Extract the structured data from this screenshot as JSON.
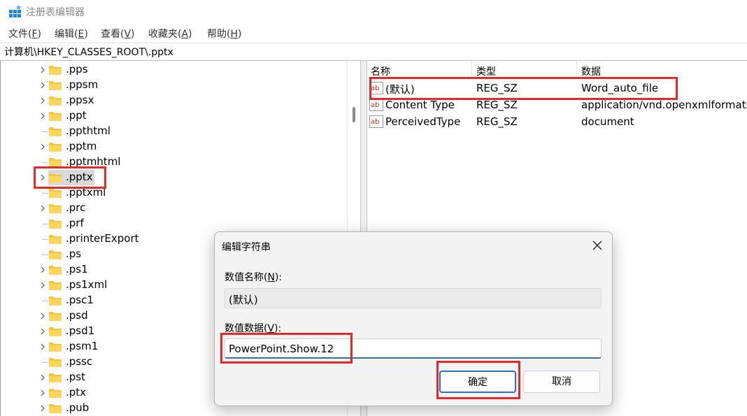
{
  "window": {
    "title": "注册表编辑器"
  },
  "menu": [
    {
      "label": "文件(",
      "key": "F",
      "suffix": ")"
    },
    {
      "label": "编辑(",
      "key": "E",
      "suffix": ")"
    },
    {
      "label": "查看(",
      "key": "V",
      "suffix": ")"
    },
    {
      "label": "收藏夹(",
      "key": "A",
      "suffix": ")"
    },
    {
      "label": "帮助(",
      "key": "H",
      "suffix": ")"
    }
  ],
  "address": "计算机\\HKEY_CLASSES_ROOT\\.pptx",
  "tree": [
    {
      "label": ".pps",
      "expandable": true
    },
    {
      "label": ".ppsm",
      "expandable": true
    },
    {
      "label": ".ppsx",
      "expandable": true
    },
    {
      "label": ".ppt",
      "expandable": true
    },
    {
      "label": ".ppthtml",
      "expandable": false
    },
    {
      "label": ".pptm",
      "expandable": true
    },
    {
      "label": ".pptmhtml",
      "expandable": false
    },
    {
      "label": ".pptx",
      "expandable": true,
      "selected": true
    },
    {
      "label": ".pptxml",
      "expandable": false
    },
    {
      "label": ".prc",
      "expandable": true
    },
    {
      "label": ".prf",
      "expandable": false
    },
    {
      "label": ".printerExport",
      "expandable": false
    },
    {
      "label": ".ps",
      "expandable": false
    },
    {
      "label": ".ps1",
      "expandable": true
    },
    {
      "label": ".ps1xml",
      "expandable": true
    },
    {
      "label": ".psc1",
      "expandable": false
    },
    {
      "label": ".psd",
      "expandable": true
    },
    {
      "label": ".psd1",
      "expandable": true
    },
    {
      "label": ".psm1",
      "expandable": true
    },
    {
      "label": ".pssc",
      "expandable": false
    },
    {
      "label": ".pst",
      "expandable": true
    },
    {
      "label": ".ptx",
      "expandable": true
    },
    {
      "label": ".pub",
      "expandable": true
    }
  ],
  "list": {
    "headers": {
      "name": "名称",
      "type": "类型",
      "data": "数据"
    },
    "rows": [
      {
        "name": "(默认)",
        "type": "REG_SZ",
        "data": "Word_auto_file"
      },
      {
        "name": "Content Type",
        "type": "REG_SZ",
        "data": "application/vnd.openxmlformats"
      },
      {
        "name": "PerceivedType",
        "type": "REG_SZ",
        "data": "document"
      }
    ]
  },
  "dialog": {
    "title": "编辑字符串",
    "name_label": {
      "pre": "数值名称(",
      "key": "N",
      "post": "):"
    },
    "name_value": "(默认)",
    "data_label": {
      "pre": "数值数据(",
      "key": "V",
      "post": "):"
    },
    "data_value": "PowerPoint.Show.12",
    "ok": "确定",
    "cancel": "取消"
  },
  "colors": {
    "highlight": "#e22a2a",
    "accent": "#2c6fb8",
    "folder": "#f5c542"
  }
}
